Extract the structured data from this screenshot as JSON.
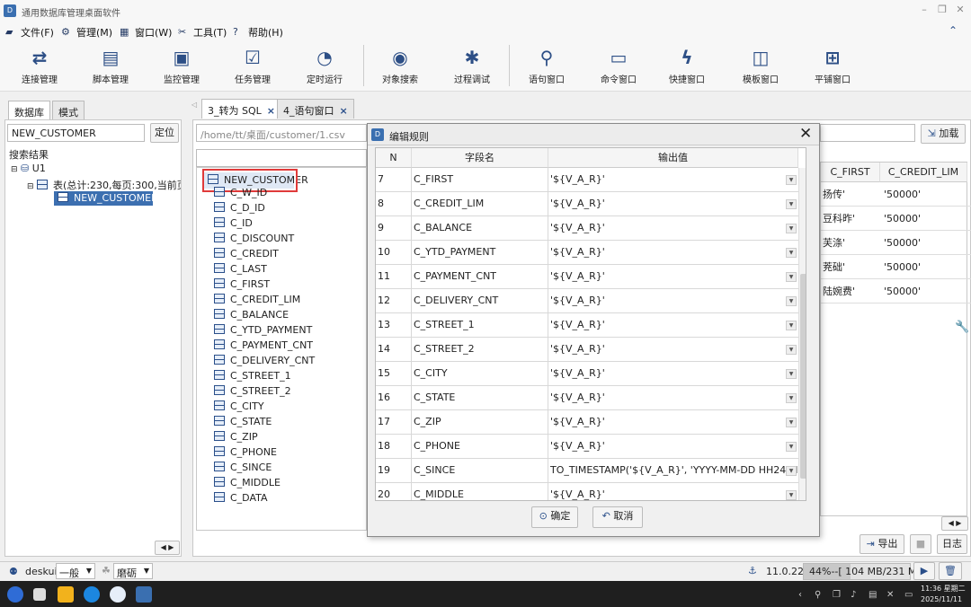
{
  "app": {
    "title": "通用数据库管理桌面软件"
  },
  "menu": [
    {
      "label": "文件(F)",
      "icon": "folder-icon"
    },
    {
      "label": "管理(M)",
      "icon": "gear-icon"
    },
    {
      "label": "窗口(W)",
      "icon": "window-icon"
    },
    {
      "label": "工具(T)",
      "icon": "tools-icon"
    },
    {
      "label": "帮助(H)",
      "icon": "help-icon"
    }
  ],
  "toolbar": [
    {
      "label": "连接管理",
      "icon": "connect-icon"
    },
    {
      "label": "脚本管理",
      "icon": "script-icon"
    },
    {
      "label": "监控管理",
      "icon": "monitor-icon"
    },
    {
      "label": "任务管理",
      "icon": "task-icon"
    },
    {
      "label": "定时运行",
      "icon": "clock-icon"
    },
    {
      "label": "对象搜索",
      "icon": "object-search-icon"
    },
    {
      "label": "过程调试",
      "icon": "debug-icon"
    },
    {
      "label": "语句窗口",
      "icon": "search-icon"
    },
    {
      "label": "命令窗口",
      "icon": "command-icon"
    },
    {
      "label": "快捷窗口",
      "icon": "lightning-icon"
    },
    {
      "label": "模板窗口",
      "icon": "template-icon"
    },
    {
      "label": "平铺窗口",
      "icon": "tile-icon"
    }
  ],
  "left": {
    "tabs": [
      "数据库",
      "模式"
    ],
    "search_value": "NEW_CUSTOMER",
    "locate_label": "定位",
    "results_label": "搜索结果",
    "tree_root": "U1",
    "tree_table_group": "表(总计:230,每页:300,当前页:1",
    "tree_table": "NEW_CUSTOMER"
  },
  "center_tabs": [
    {
      "label": "3_转为 SQL"
    },
    {
      "label": "4_语句窗口"
    }
  ],
  "middle": {
    "path": "/home/tt/桌面/customer/1.csv",
    "table": "NEW_CUSTOMER",
    "fields": [
      "C_W_ID",
      "C_D_ID",
      "C_ID",
      "C_DISCOUNT",
      "C_CREDIT",
      "C_LAST",
      "C_FIRST",
      "C_CREDIT_LIM",
      "C_BALANCE",
      "C_YTD_PAYMENT",
      "C_PAYMENT_CNT",
      "C_DELIVERY_CNT",
      "C_STREET_1",
      "C_STREET_2",
      "C_CITY",
      "C_STATE",
      "C_ZIP",
      "C_PHONE",
      "C_SINCE",
      "C_MIDDLE",
      "C_DATA"
    ]
  },
  "right": {
    "load_label": "加载",
    "columns": [
      "C_FIRST",
      "C_CREDIT_LIM"
    ],
    "rows": [
      [
        "扬传'",
        "'50000'"
      ],
      [
        "豆科昨'",
        "'50000'"
      ],
      [
        "芙涤'",
        "'50000'"
      ],
      [
        "茺础'",
        "'50000'"
      ],
      [
        "陆婉费'",
        "'50000'"
      ]
    ],
    "export_label": "导出",
    "log_label": "日志"
  },
  "dialog": {
    "title": "编辑规则",
    "col_n": "N",
    "col_field": "字段名",
    "col_value": "输出值",
    "rows": [
      [
        "7",
        "C_FIRST",
        "'${V_A_R}'"
      ],
      [
        "8",
        "C_CREDIT_LIM",
        "'${V_A_R}'"
      ],
      [
        "9",
        "C_BALANCE",
        "'${V_A_R}'"
      ],
      [
        "10",
        "C_YTD_PAYMENT",
        "'${V_A_R}'"
      ],
      [
        "11",
        "C_PAYMENT_CNT",
        "'${V_A_R}'"
      ],
      [
        "12",
        "C_DELIVERY_CNT",
        "'${V_A_R}'"
      ],
      [
        "13",
        "C_STREET_1",
        "'${V_A_R}'"
      ],
      [
        "14",
        "C_STREET_2",
        "'${V_A_R}'"
      ],
      [
        "15",
        "C_CITY",
        "'${V_A_R}'"
      ],
      [
        "16",
        "C_STATE",
        "'${V_A_R}'"
      ],
      [
        "17",
        "C_ZIP",
        "'${V_A_R}'"
      ],
      [
        "18",
        "C_PHONE",
        "'${V_A_R}'"
      ],
      [
        "19",
        "C_SINCE",
        "TO_TIMESTAMP('${V_A_R}', 'YYYY-MM-DD HH24:MI:SS.FF3')"
      ],
      [
        "20",
        "C_MIDDLE",
        "'${V_A_R}'"
      ]
    ],
    "ok_label": "确定",
    "cancel_label": "取消"
  },
  "status": {
    "user": "deskui",
    "mode": "一般",
    "theme": "磨砺",
    "version": "11.0.22",
    "memory": "44%--[ 104 MB/231 MB ]"
  },
  "taskbar": {
    "time": "11:36 星期二",
    "date": "2025/11/11"
  }
}
